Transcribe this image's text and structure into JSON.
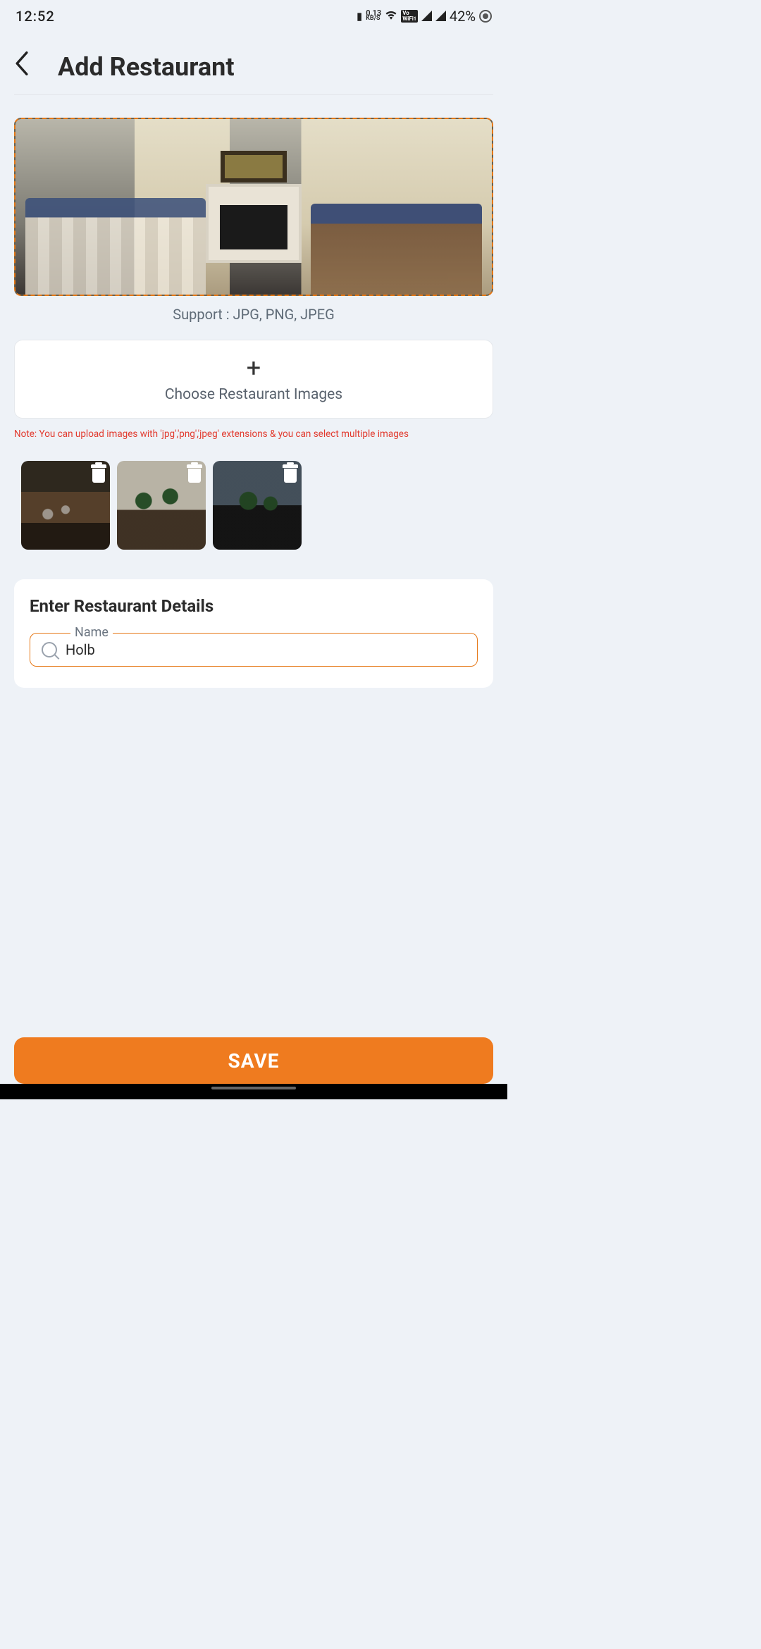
{
  "status": {
    "time": "12:52",
    "net_rate_value": "0.13",
    "net_rate_unit": "KB/S",
    "vowifi_top": "Vo",
    "vowifi_bottom": "WiFi",
    "vowifi_sup": "1",
    "battery": "42%"
  },
  "header": {
    "title": "Add Restaurant"
  },
  "upload": {
    "support_text": "Support : JPG, PNG, JPEG",
    "choose_label": "Choose Restaurant Images",
    "plus": "+",
    "note": "Note: You can upload images with 'jpg','png','jpeg' extensions & you can select multiple images"
  },
  "thumbnails": [
    {
      "alt": "restaurant-image-1"
    },
    {
      "alt": "restaurant-image-2"
    },
    {
      "alt": "restaurant-image-3"
    }
  ],
  "details": {
    "section_title": "Enter Restaurant Details",
    "name_label": "Name",
    "name_value": "Holb"
  },
  "actions": {
    "save": "SAVE"
  }
}
